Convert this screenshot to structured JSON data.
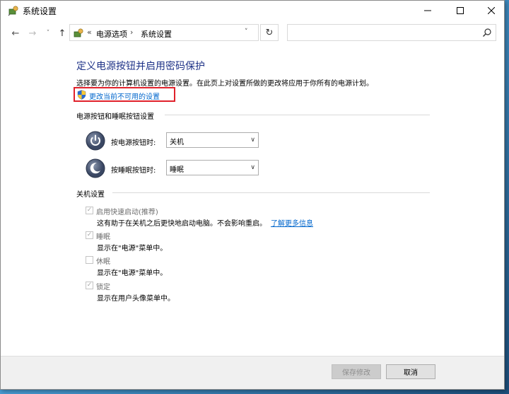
{
  "window": {
    "title": "系统设置"
  },
  "titlebar_buttons": {
    "minimize": "—",
    "maximize": "☐",
    "close": "✕"
  },
  "nav": {
    "back": "←",
    "forward": "→",
    "dropdown": "˅",
    "up": "↑"
  },
  "address": {
    "separator": "«",
    "crumbs": [
      "电源选项",
      "系统设置"
    ],
    "crumb_sep": "›",
    "dropdown": "˅",
    "refresh": "↻"
  },
  "search": {
    "placeholder": ""
  },
  "content": {
    "title": "定义电源按钮并启用密码保护",
    "description": "选择要为你的计算机设置的电源设置。在此页上对设置所做的更改将应用于你所有的电源计划。",
    "change_link": "更改当前不可用的设置",
    "power_section_header": "电源按钮和睡眠按钮设置",
    "power_button": {
      "label": "按电源按钮时:",
      "value": "关机"
    },
    "sleep_button": {
      "label": "按睡眠按钮时:",
      "value": "睡眠"
    },
    "shutdown_section_header": "关机设置",
    "shutdown_options": [
      {
        "label": "启用快速启动(推荐)",
        "checked": true,
        "description": "这有助于在关机之后更快地启动电脑。不会影响重启。",
        "link": "了解更多信息"
      },
      {
        "label": "睡眠",
        "checked": true,
        "description": "显示在\"电源\"菜单中。"
      },
      {
        "label": "休眠",
        "checked": false,
        "description": "显示在\"电源\"菜单中。"
      },
      {
        "label": "锁定",
        "checked": true,
        "description": "显示在用户头像菜单中。"
      }
    ]
  },
  "footer": {
    "save_label": "保存修改",
    "cancel_label": "取消"
  },
  "colors": {
    "title_blue": "#1e3287",
    "link_blue": "#0066cc",
    "highlight_red": "#e0212b"
  }
}
